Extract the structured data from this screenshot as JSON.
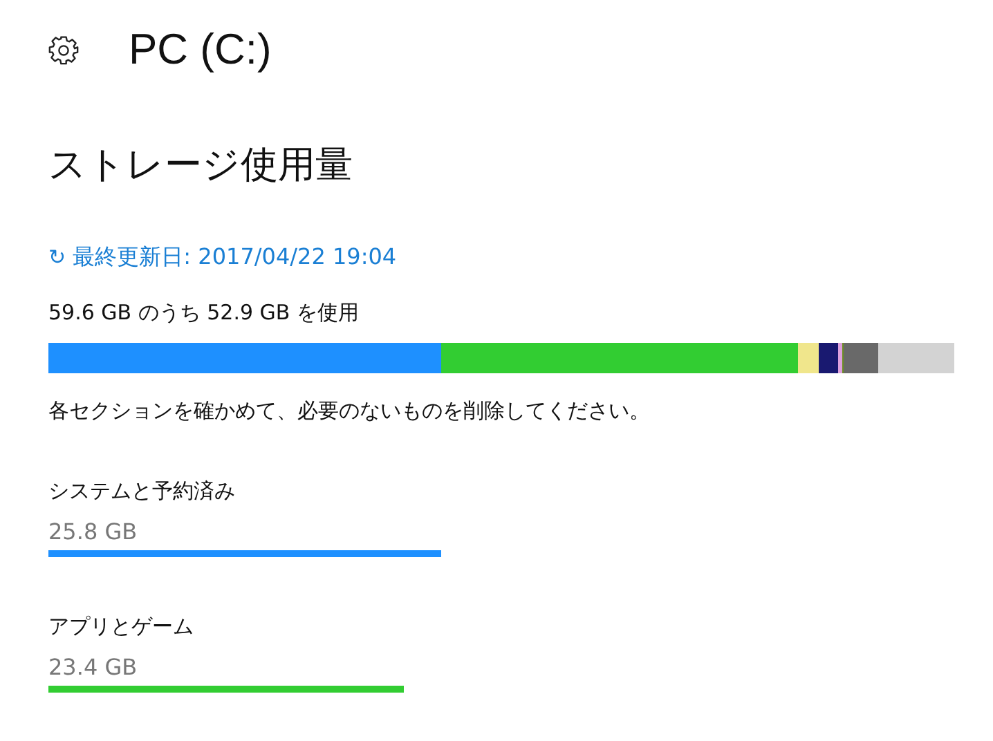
{
  "window": {
    "title": "PC (C:)"
  },
  "heading": "ストレージ使用量",
  "refresh": {
    "icon": "↻",
    "label": "最終更新日: 2017/04/22 19:04"
  },
  "usage_summary": "59.6 GB のうち 52.9 GB を使用",
  "usage_bar": [
    {
      "color": "#1e90ff"
    },
    {
      "color": "#32cd32"
    },
    {
      "color": "#f0e68c"
    },
    {
      "color": "#191970"
    },
    {
      "color": "#dda0dd"
    },
    {
      "color": "#6b8e23"
    },
    {
      "color": "#696969"
    }
  ],
  "instruction": "各セクションを確かめて、必要のないものを削除してください。",
  "categories": [
    {
      "name": "システムと予約済み",
      "size": "25.8 GB",
      "color": "#1e90ff"
    },
    {
      "name": "アプリとゲーム",
      "size": "23.4 GB",
      "color": "#32cd32"
    }
  ]
}
